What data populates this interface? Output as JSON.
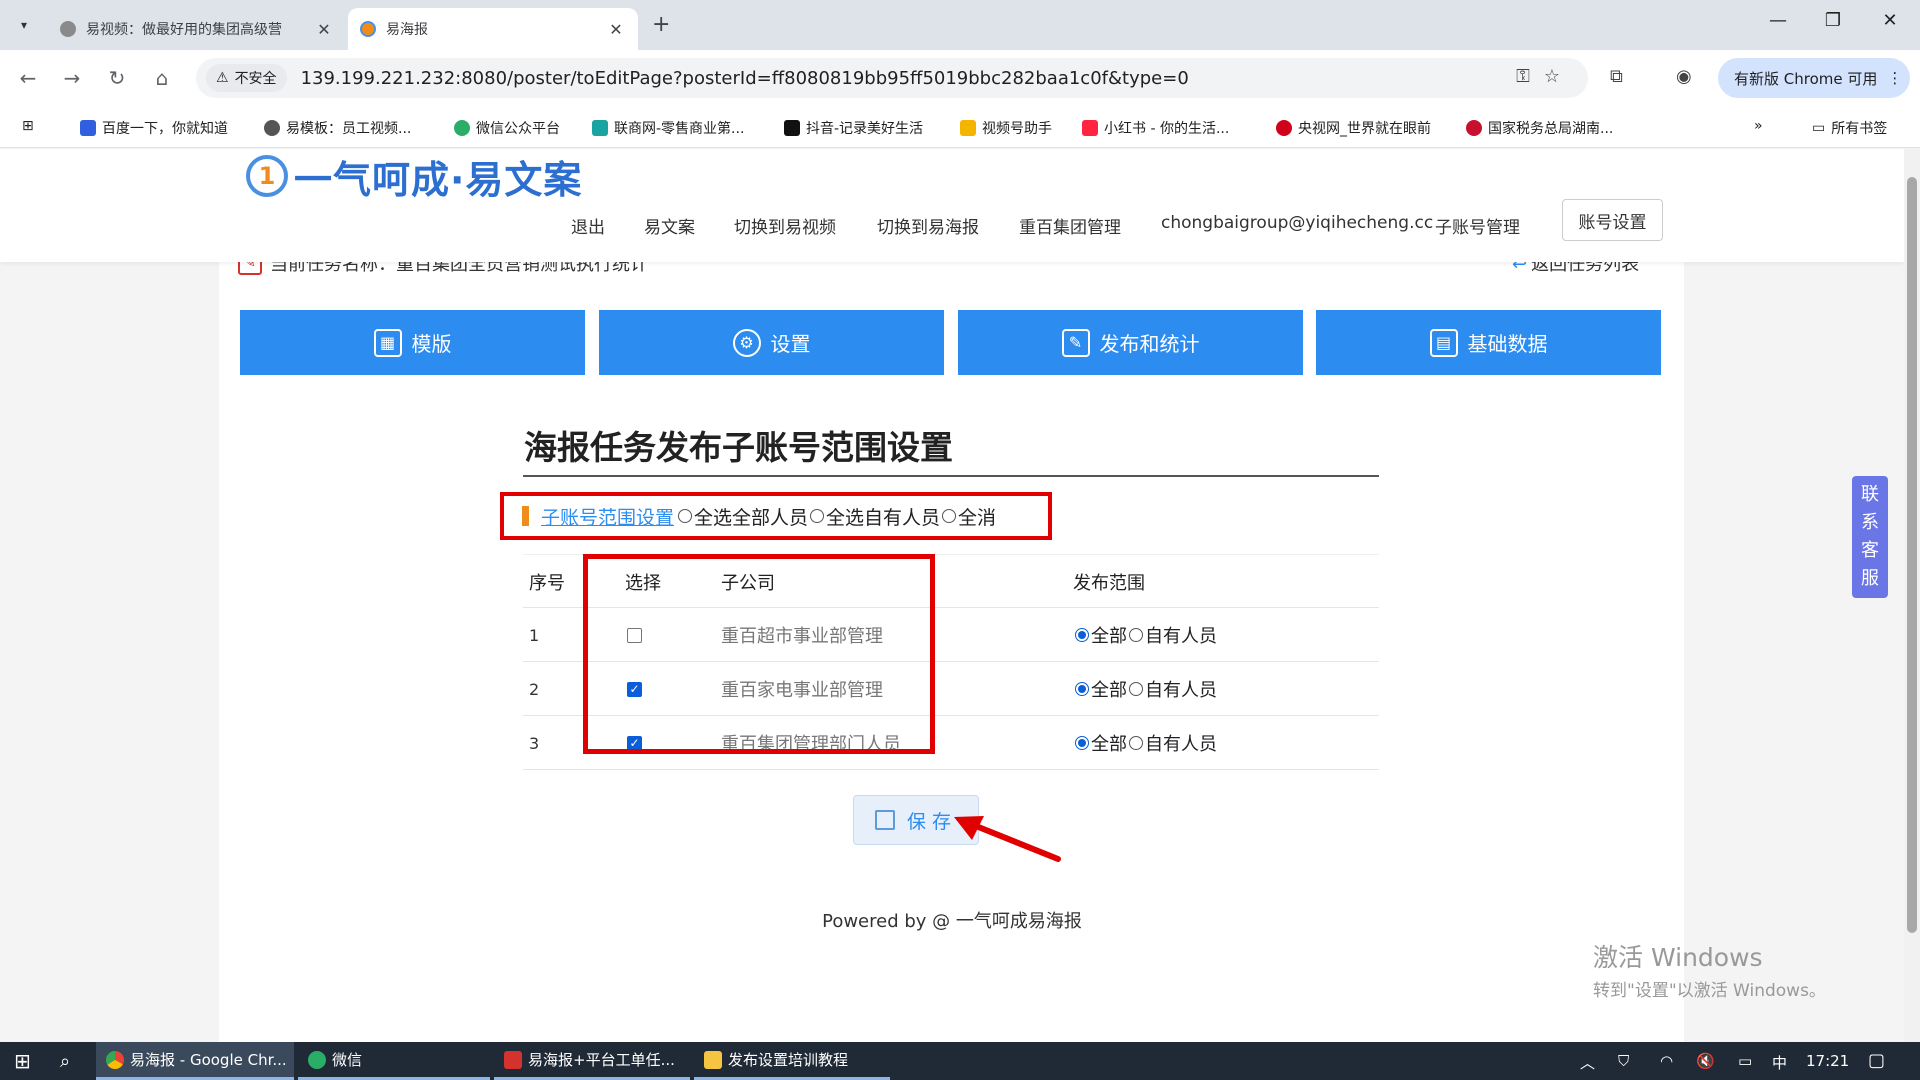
{
  "browser": {
    "tabs": [
      {
        "title": "易视频：做最好用的集团高级营"
      },
      {
        "title": "易海报"
      }
    ],
    "insecure_label": "不安全",
    "url": "139.199.221.232:8080/poster/toEditPage?posterId=ff8080819bb95ff5019bbc282baa1c0f&type=0",
    "update_label": "有新版 Chrome 可用",
    "bookmarks": [
      "百度一下，你就知道",
      "易模板：员工视频...",
      "微信公众平台",
      "联商网-零售商业第...",
      "抖音-记录美好生活",
      "视频号助手",
      "小红书 - 你的生活...",
      "央视网_世界就在眼前",
      "国家税务总局湖南..."
    ],
    "all_bookmarks": "所有书签",
    "colors": {
      "accent": "#2d8cf0",
      "annotation_red": "#e00000",
      "header_blue": "#2c6fd1"
    }
  },
  "site": {
    "logo_text": "一气呵成·易文案",
    "nav": [
      "退出",
      "易文案",
      "切换到易视频",
      "切换到易海报",
      "重百集团管理",
      "chongbaigroup@yiqihecheng.cc",
      "子账号管理"
    ],
    "account_button": "账号设置",
    "task_line": "当前任务名称：重百集团全员营销测试执行统计",
    "back_link": "返回任务列表",
    "blue_tabs": [
      "模版",
      "设置",
      "发布和统计",
      "基础数据"
    ],
    "page_title": "海报任务发布子账号范围设置",
    "scope": {
      "link": "子账号范围设置",
      "options": [
        "全选全部人员",
        "全选自有人员",
        "全消"
      ]
    },
    "table": {
      "headers": [
        "序号",
        "选择",
        "子公司",
        "发布范围"
      ],
      "rows": [
        {
          "index": "1",
          "checked": false,
          "company": "重百超市事业部管理",
          "scope_all": "全部",
          "scope_own": "自有人员"
        },
        {
          "index": "2",
          "checked": true,
          "company": "重百家电事业部管理",
          "scope_all": "全部",
          "scope_own": "自有人员"
        },
        {
          "index": "3",
          "checked": true,
          "company": "重百集团管理部门人员",
          "scope_all": "全部",
          "scope_own": "自有人员"
        }
      ]
    },
    "save_label": "保存",
    "powered": "Powered by @ 一气呵成易海报",
    "side_service": [
      "联",
      "系",
      "客",
      "服"
    ]
  },
  "watermark": {
    "line1": "激活 Windows",
    "line2": "转到\"设置\"以激活 Windows。"
  },
  "taskbar": {
    "items": [
      "易海报 - Google Chr...",
      "微信",
      "易海报+平台工单任...",
      "发布设置培训教程"
    ],
    "ime": "中",
    "time": "17:21"
  }
}
